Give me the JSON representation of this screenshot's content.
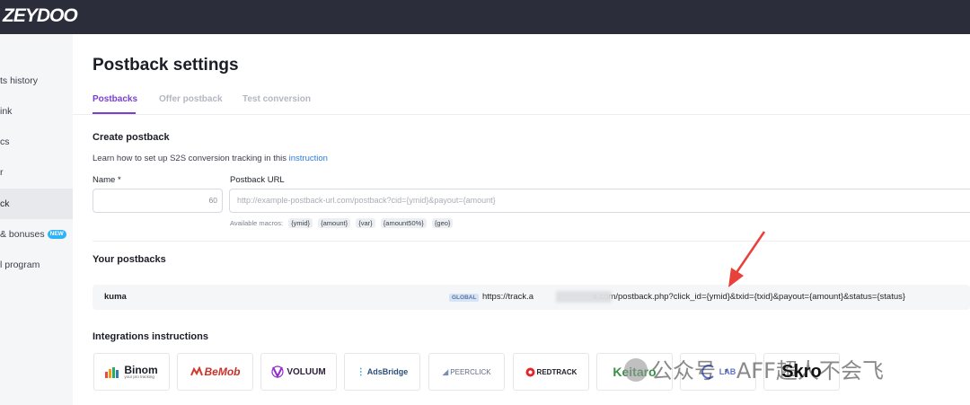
{
  "app": {
    "logo": "ZEYDOO"
  },
  "sidebar": {
    "items": [
      {
        "label": "ts history"
      },
      {
        "label": "ink"
      },
      {
        "label": "cs"
      },
      {
        "label": "r"
      },
      {
        "label": "ck"
      },
      {
        "label": "& bonuses",
        "badge": "NEW"
      },
      {
        "label": "l program"
      }
    ]
  },
  "page": {
    "title": "Postback settings"
  },
  "tabs": [
    {
      "label": "Postbacks"
    },
    {
      "label": "Offer postback"
    },
    {
      "label": "Test conversion"
    }
  ],
  "create": {
    "title": "Create postback",
    "help_text": "Learn how to set up S2S conversion tracking in this ",
    "help_link": "instruction",
    "name_label": "Name *",
    "name_counter": "60",
    "url_label": "Postback URL",
    "url_placeholder": "http://example-postback-url.com/postback?cid={ymid}&payout={amount}",
    "macros_label": "Available macros:",
    "macros": [
      "{ymid}",
      "{amount}",
      "{var}",
      "{amount50%}",
      "{geo}"
    ]
  },
  "your_postbacks": {
    "title": "Your postbacks",
    "items": [
      {
        "name": "kuma",
        "badge": "GLOBAL",
        "url_start": "https://track.a",
        "url_end": "s.com/postback.php?click_id={ymid}&txid={txid}&payout={amount}&status={status}"
      }
    ]
  },
  "integrations": {
    "title": "Integrations instructions",
    "logos": [
      {
        "name": "Binom",
        "sub": "your pro tracking"
      },
      {
        "name": "BeMob"
      },
      {
        "name": "VOLUUM"
      },
      {
        "name": "AdsBridge"
      },
      {
        "name": "PEERCLICK"
      },
      {
        "name": "REDTRACK"
      },
      {
        "name": "Keitaro"
      },
      {
        "name": "LAB"
      },
      {
        "name": "Skro"
      }
    ]
  },
  "watermark": {
    "text": "公众号 · AFF超人不会飞"
  },
  "colors": {
    "accent": "#7a3fd0",
    "link": "#2a7de1",
    "topbar": "#2b2d3a",
    "annotation_arrow": "#e8403a"
  }
}
